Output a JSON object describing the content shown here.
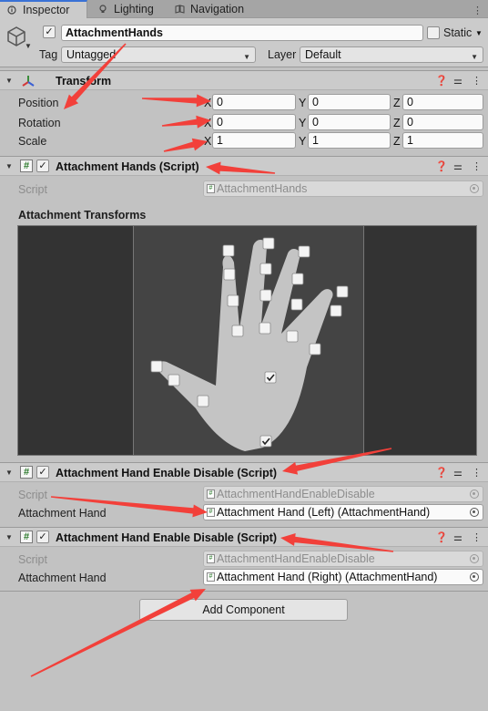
{
  "tabs": [
    {
      "label": "Inspector",
      "icon": "info-icon"
    },
    {
      "label": "Lighting",
      "icon": "lightbulb-icon"
    },
    {
      "label": "Navigation",
      "icon": "navigation-icon"
    }
  ],
  "object": {
    "active": true,
    "name": "AttachmentHands",
    "static_label": "Static",
    "static_checked": false,
    "tag_label": "Tag",
    "tag_value": "Untagged",
    "layer_label": "Layer",
    "layer_value": "Default"
  },
  "transform": {
    "title": "Transform",
    "position": {
      "label": "Position",
      "x": "0",
      "y": "0",
      "z": "0"
    },
    "rotation": {
      "label": "Rotation",
      "x": "0",
      "y": "0",
      "z": "0"
    },
    "scale": {
      "label": "Scale",
      "x": "1",
      "y": "1",
      "z": "1"
    },
    "axis_x": "X",
    "axis_y": "Y",
    "axis_z": "Z"
  },
  "attachment_hands": {
    "title": "Attachment Hands (Script)",
    "enabled": true,
    "script_label": "Script",
    "script_value": "AttachmentHands",
    "transforms_label": "Attachment Transforms"
  },
  "enable_disable_left": {
    "title": "Attachment Hand Enable Disable (Script)",
    "enabled": true,
    "script_label": "Script",
    "script_value": "AttachmentHandEnableDisable",
    "hand_label": "Attachment Hand",
    "hand_value": "Attachment Hand (Left) (AttachmentHand)"
  },
  "enable_disable_right": {
    "title": "Attachment Hand Enable Disable (Script)",
    "enabled": true,
    "script_label": "Script",
    "script_value": "AttachmentHandEnableDisable",
    "hand_label": "Attachment Hand",
    "hand_value": "Attachment Hand (Right) (AttachmentHand)"
  },
  "add_component_label": "Add Component",
  "colors": {
    "annotation_arrow": "#f2403a",
    "tab_accent": "#3a72d6",
    "hand_fill": "#c4c4c4"
  }
}
